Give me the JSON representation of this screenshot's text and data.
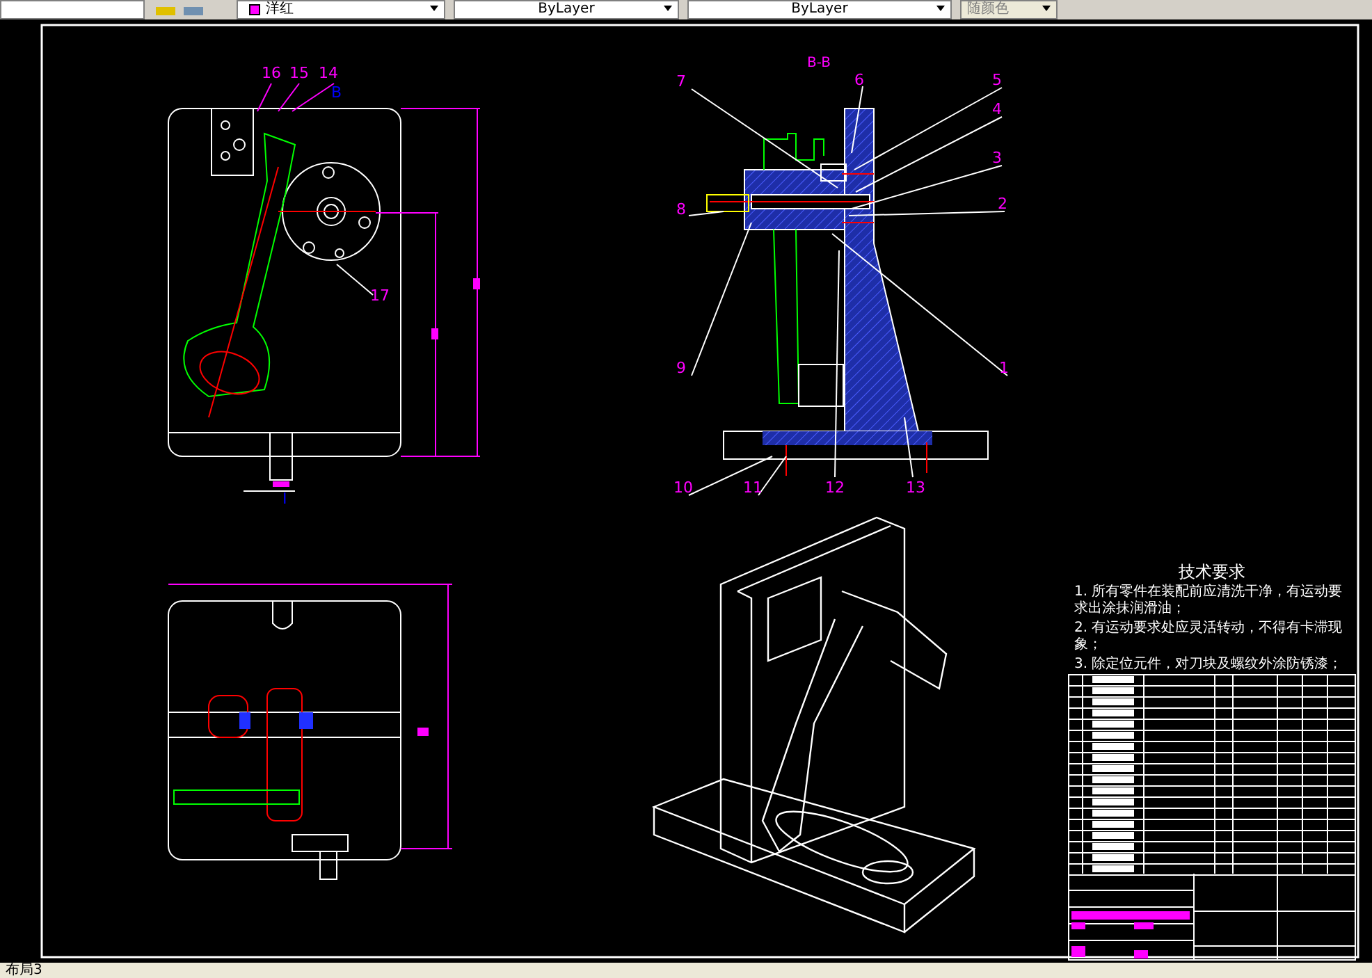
{
  "toolbar": {
    "color_dropdown": "洋红",
    "linetype_dropdown": "ByLayer",
    "lineweight_dropdown": "ByLayer",
    "plotstyle_dropdown": "随颜色"
  },
  "front_view": {
    "labels": [
      {
        "text": "16",
        "color": "#ff00ff"
      },
      {
        "text": "15",
        "color": "#ff00ff"
      },
      {
        "text": "14",
        "color": "#ff00ff"
      },
      {
        "text": "B",
        "color": "#0000ff"
      },
      {
        "text": "17",
        "color": "#ff00ff"
      },
      {
        "text": "I",
        "color": "#0000ff"
      }
    ]
  },
  "section_view": {
    "title": "B-B",
    "labels": [
      "7",
      "6",
      "5",
      "4",
      "3",
      "2",
      "8",
      "1",
      "9",
      "10",
      "11",
      "12",
      "13"
    ]
  },
  "technical_requirements": {
    "title": "技术要求",
    "items": [
      "1. 所有零件在装配前应清洗干净，有运动要求出涂抹润滑油；",
      "2. 有运动要求处应灵活转动，不得有卡滞现象；",
      "3. 除定位元件，对刀块及螺纹外涂防锈漆；"
    ]
  },
  "layout_tab": "布局3"
}
